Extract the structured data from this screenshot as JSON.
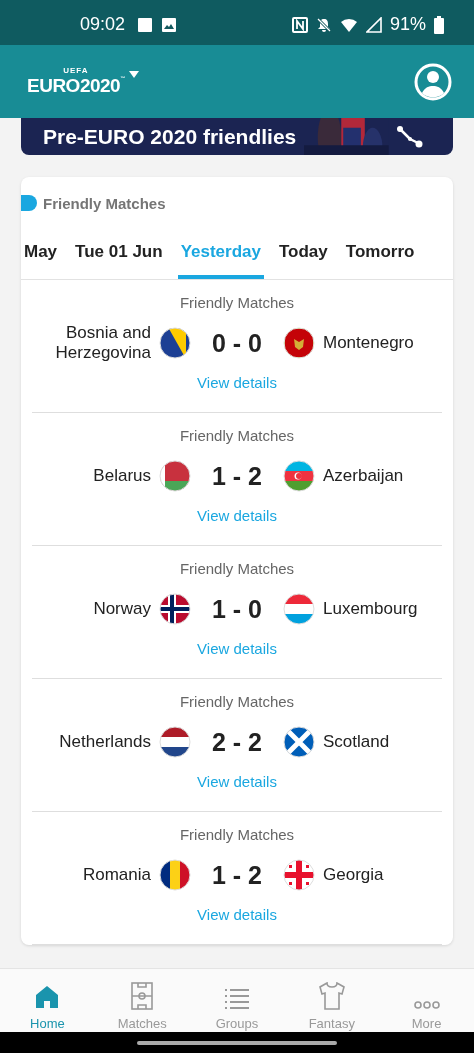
{
  "status_bar": {
    "time": "09:02",
    "battery": "91%"
  },
  "app_bar": {
    "logo_small": "UEFA",
    "logo": "EURO2020",
    "trademark": "™"
  },
  "banner": {
    "title": "Pre-EURO 2020 friendlies"
  },
  "section": {
    "title": "Friendly Matches"
  },
  "tabs": [
    {
      "label": "May",
      "selected": false
    },
    {
      "label": "Tue 01 Jun",
      "selected": false
    },
    {
      "label": "Yesterday",
      "selected": true
    },
    {
      "label": "Today",
      "selected": false
    },
    {
      "label": "Tomorro",
      "selected": false
    }
  ],
  "matches": [
    {
      "competition": "Friendly Matches",
      "home": "Bosnia and Herzegovina",
      "score": "0 - 0",
      "away": "Montenegro",
      "link": "View details"
    },
    {
      "competition": "Friendly Matches",
      "home": "Belarus",
      "score": "1 - 2",
      "away": "Azerbaijan",
      "link": "View details"
    },
    {
      "competition": "Friendly Matches",
      "home": "Norway",
      "score": "1 - 0",
      "away": "Luxembourg",
      "link": "View details"
    },
    {
      "competition": "Friendly Matches",
      "home": "Netherlands",
      "score": "2 - 2",
      "away": "Scotland",
      "link": "View details"
    },
    {
      "competition": "Friendly Matches",
      "home": "Romania",
      "score": "1 - 2",
      "away": "Georgia",
      "link": "View details"
    }
  ],
  "nav": [
    {
      "label": "Home",
      "selected": true
    },
    {
      "label": "Matches",
      "selected": false
    },
    {
      "label": "Groups",
      "selected": false
    },
    {
      "label": "Fantasy",
      "selected": false
    },
    {
      "label": "More",
      "selected": false
    }
  ]
}
